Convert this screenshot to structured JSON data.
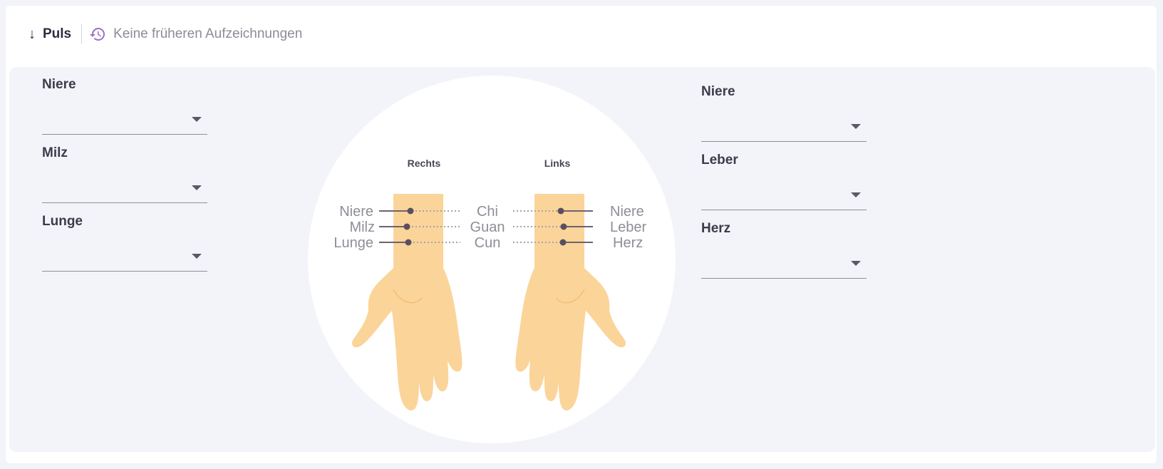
{
  "toolbar": {
    "toggle_label": "Puls",
    "history_text": "Keine früheren Aufzeichnungen",
    "icons": {
      "toggle": "arrow-down-icon",
      "history": "history-icon"
    },
    "accent": "#9c6fc4"
  },
  "left_fields": [
    {
      "label": "Niere",
      "value": ""
    },
    {
      "label": "Milz",
      "value": ""
    },
    {
      "label": "Lunge",
      "value": ""
    }
  ],
  "right_fields": [
    {
      "label": "Niere",
      "value": ""
    },
    {
      "label": "Leber",
      "value": ""
    },
    {
      "label": "Herz",
      "value": ""
    }
  ],
  "diagram": {
    "right_hand_title": "Rechts",
    "left_hand_title": "Links",
    "right_labels": [
      "Niere",
      "Milz",
      "Lunge"
    ],
    "positions": [
      "Chi",
      "Guan",
      "Cun"
    ],
    "left_labels": [
      "Niere",
      "Leber",
      "Herz"
    ],
    "skin_color": "#fbd49a",
    "marker_color": "#5a4f5e"
  }
}
